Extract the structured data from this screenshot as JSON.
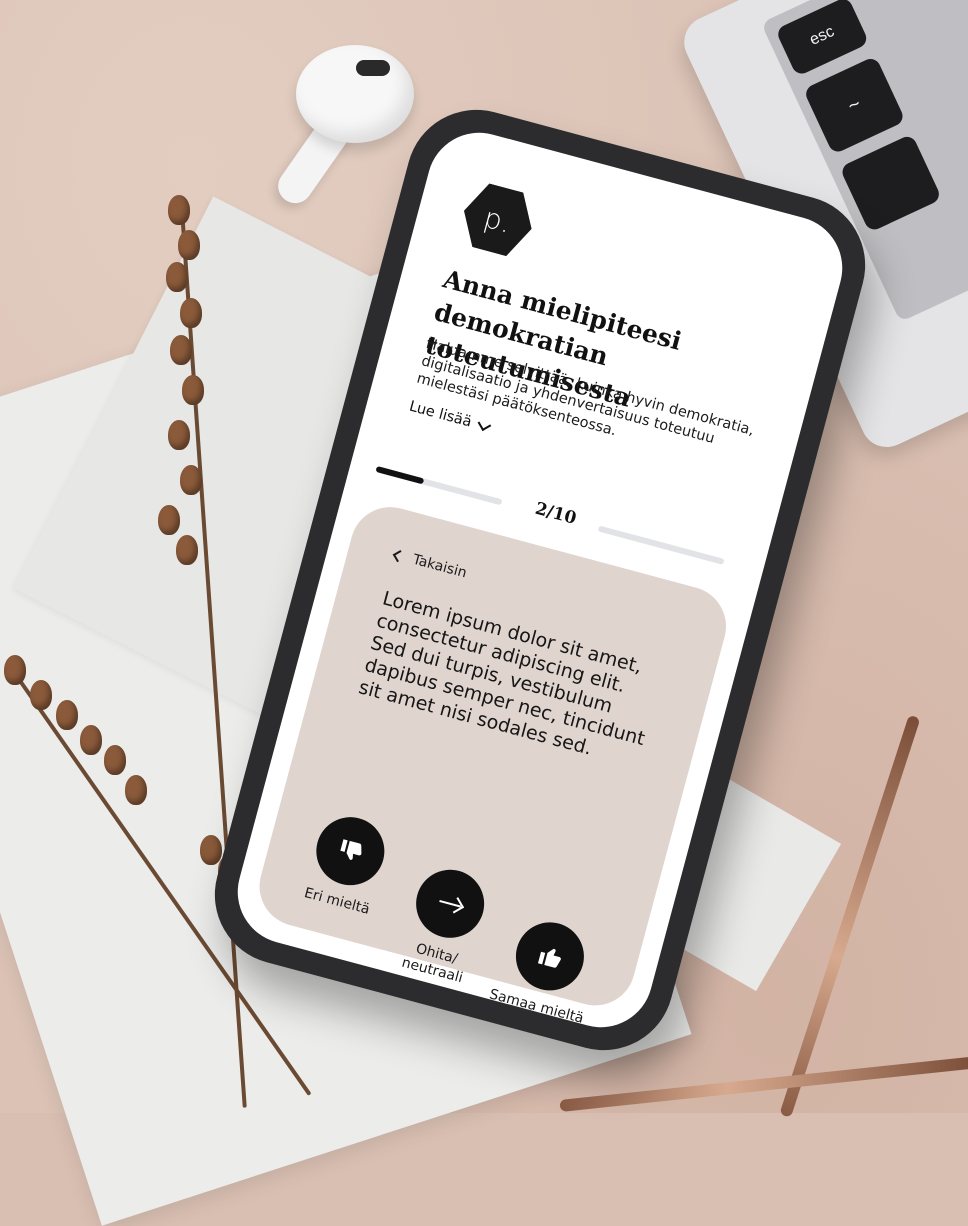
{
  "background": {
    "laptop_keys": {
      "esc": "esc",
      "tilde": "~"
    }
  },
  "app": {
    "logo_text": "p.",
    "title": "Anna mielipiteesi demokratian toteutumisesta",
    "intro": "Haluamme selvittää, kuinka hyvin demokratia, digitalisaatio ja yhdenvertaisuus toteutuu mielestäsi päätöksenteossa.",
    "read_more": "Lue lisää",
    "progress": {
      "current": 2,
      "total": 10,
      "label": "2/10"
    },
    "card": {
      "back_label": "Takaisin",
      "statement": "Lorem ipsum dolor sit amet, consectetur adipiscing elit. Sed dui turpis, vestibulum dapibus semper nec, tincidunt sit amet nisi sodales sed.",
      "actions": [
        {
          "icon": "thumbs-down-icon",
          "label": "Eri mieltä"
        },
        {
          "icon": "arrow-right-icon",
          "label": "Ohita/ neutraali"
        },
        {
          "icon": "thumbs-up-icon",
          "label": "Samaa mieltä"
        }
      ]
    }
  },
  "colors": {
    "background": "#dbc2b5",
    "card": "#e0d4ce",
    "phone_frame": "#2c2c2e",
    "primary": "#111111"
  }
}
